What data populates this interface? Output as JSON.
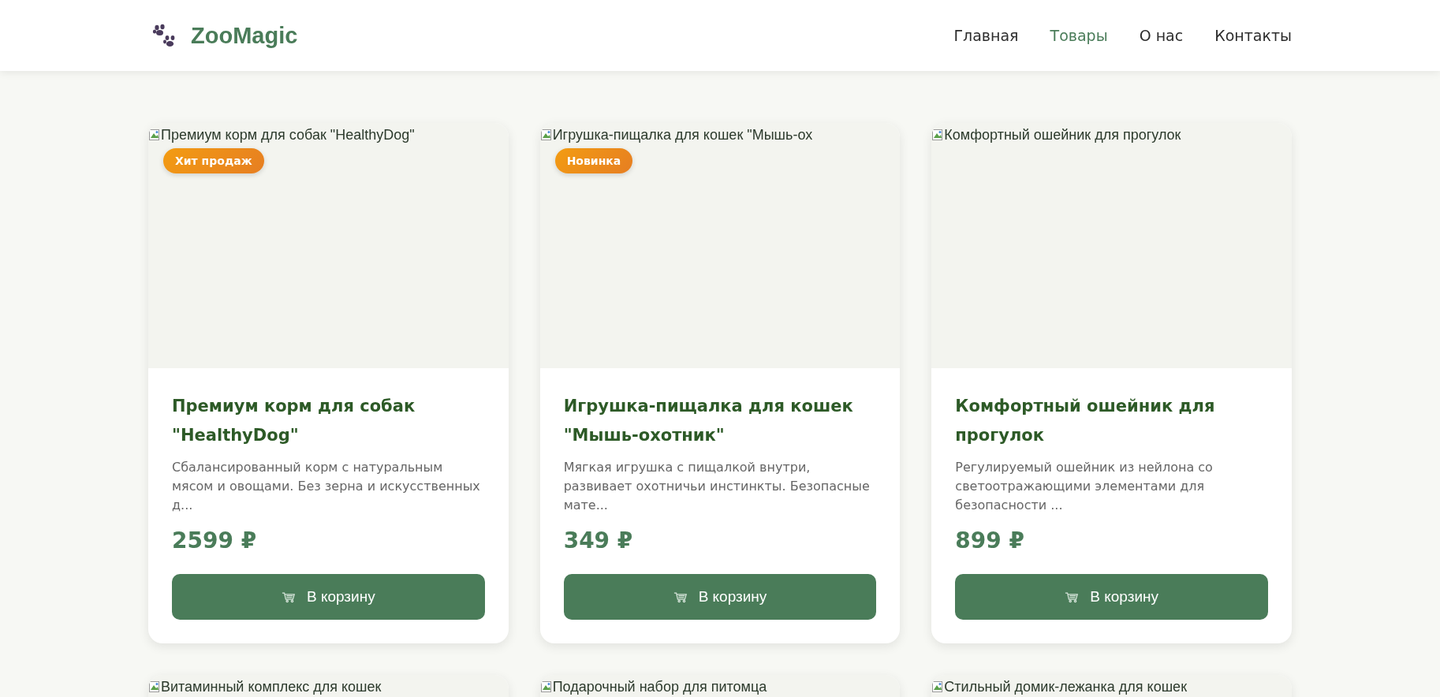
{
  "header": {
    "logo": "ZooMagic",
    "nav": [
      {
        "label": "Главная",
        "selected": false
      },
      {
        "label": "Товары",
        "selected": true
      },
      {
        "label": "О нас",
        "selected": false
      },
      {
        "label": "Контакты",
        "selected": false
      }
    ]
  },
  "products": [
    {
      "image_alt": "Премиум корм для собак \"HealthyDog\"",
      "badge": "Хит продаж",
      "title": "Премиум корм для собак \"HealthyDog\"",
      "description": "Сбалансированный корм с натуральным мясом и овощами. Без зерна и искусственных д...",
      "price": "2599 ₽",
      "button": "В корзину"
    },
    {
      "image_alt": "Игрушка-пищалка для кошек \"Мышь-ох",
      "badge": "Новинка",
      "title": "Игрушка-пищалка для кошек \"Мышь-охотник\"",
      "description": "Мягкая игрушка с пищалкой внутри, развивает охотничьи инстинкты. Безопасные мате...",
      "price": "349 ₽",
      "button": "В корзину"
    },
    {
      "image_alt": "Комфортный ошейник для прогулок",
      "title": "Комфортный ошейник для прогулок",
      "description": "Регулируемый ошейник из нейлона со светоотражающими элементами для безопасности ...",
      "price": "899 ₽",
      "button": "В корзину"
    },
    {
      "image_alt": "Витаминный комплекс для кошек"
    },
    {
      "image_alt": "Подарочный набор для питомца"
    },
    {
      "image_alt": "Стильный домик-лежанка для кошек"
    }
  ]
}
